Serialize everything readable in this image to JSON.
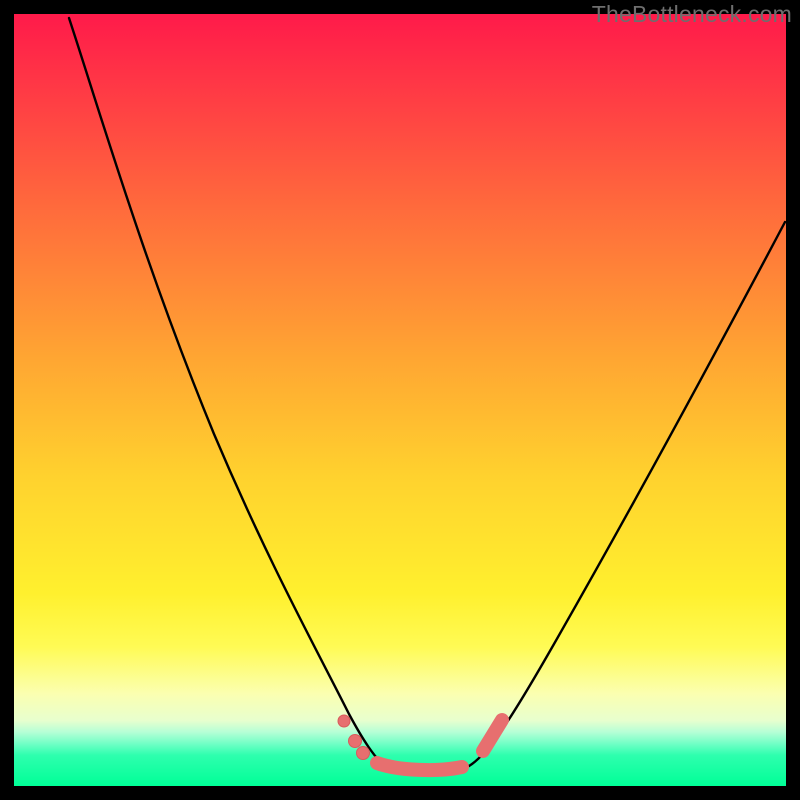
{
  "watermark": "TheBottleneck.com",
  "colors": {
    "background_frame": "#000000",
    "curve_stroke": "#000000",
    "marker_fill": "#e76f6f",
    "marker_stroke": "#d85c5c",
    "gradient_stops": [
      "#ff1a4a",
      "#ff3a45",
      "#ff6a3c",
      "#ffa732",
      "#ffd22e",
      "#fff02e",
      "#fffb55",
      "#fbffb0",
      "#e8ffce",
      "#b6ffd6",
      "#72ffc6",
      "#2effae",
      "#00ff97"
    ]
  },
  "chart_data": {
    "type": "line",
    "title": "",
    "xlabel": "",
    "ylabel": "",
    "xlim": [
      0,
      100
    ],
    "ylim": [
      0,
      100
    ],
    "grid": false,
    "legend": null,
    "note": "Axes are unlabeled in the source image; x/y values are pixel-derived and normalized to 0–100. The curve is a V-shaped bottleneck profile (two descending arms meeting at a flat trough).",
    "series": [
      {
        "name": "left-arm",
        "x": [
          7.1,
          12.0,
          20.0,
          28.1,
          34.5,
          39.4,
          42.4,
          44.6,
          47.3
        ],
        "y": [
          99.5,
          86.5,
          64.2,
          42.6,
          26.4,
          14.0,
          7.6,
          4.1,
          2.5
        ]
      },
      {
        "name": "trough",
        "x": [
          47.3,
          50.0,
          53.0,
          56.0,
          58.9
        ],
        "y": [
          2.5,
          2.0,
          1.9,
          2.1,
          2.6
        ]
      },
      {
        "name": "right-arm",
        "x": [
          58.9,
          62.2,
          66.7,
          73.8,
          81.9,
          90.9,
          99.9
        ],
        "y": [
          2.6,
          6.2,
          14.0,
          27.7,
          42.6,
          57.8,
          73.1
        ]
      }
    ],
    "markers": {
      "name": "trough-markers",
      "note": "Salmon-colored dots/capsules near the valley of the curve.",
      "points": [
        {
          "x": 42.7,
          "y": 8.4,
          "kind": "dot"
        },
        {
          "x": 44.2,
          "y": 5.8,
          "kind": "dot"
        },
        {
          "x": 45.2,
          "y": 4.3,
          "kind": "dot"
        },
        {
          "x": 47.0,
          "y": 3.0,
          "kind": "capsule-start"
        },
        {
          "x": 58.0,
          "y": 2.5,
          "kind": "capsule-end"
        },
        {
          "x": 60.8,
          "y": 4.5,
          "kind": "capsule2-start"
        },
        {
          "x": 63.2,
          "y": 8.4,
          "kind": "capsule2-end"
        }
      ]
    }
  }
}
